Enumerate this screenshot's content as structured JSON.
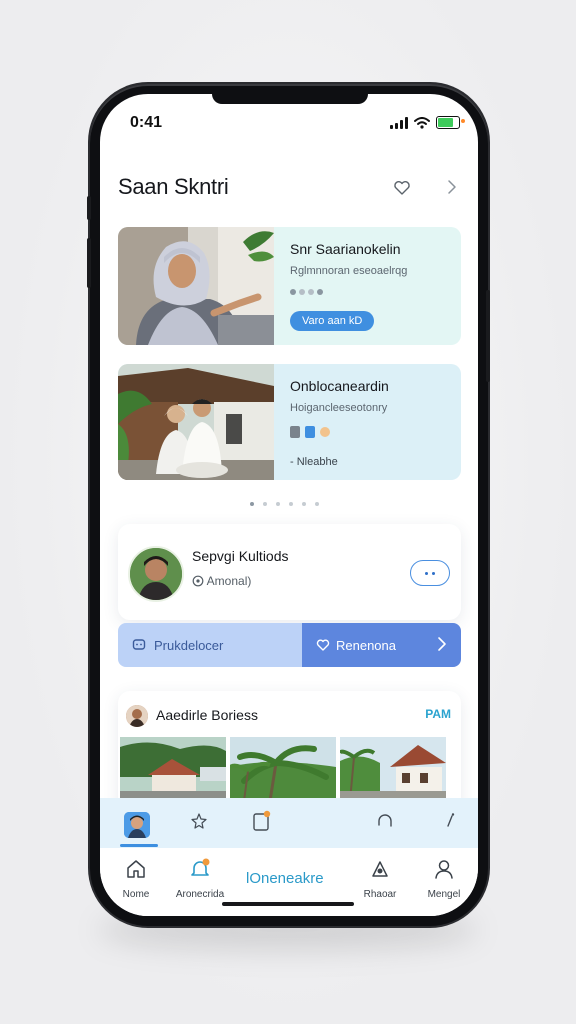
{
  "status_bar": {
    "time": "0:41"
  },
  "header": {
    "title": "Saan Skntri"
  },
  "cards": [
    {
      "title": "Snr Saarianokelin",
      "subtitle": "Rglmnnoran eseoaelrqg",
      "button_label": "Varo aan kD"
    },
    {
      "title": "Onblocaneardin",
      "subtitle": "Hoigancleeseotonry",
      "footer": "Nleabhe"
    }
  ],
  "profile": {
    "name": "Sepvgi Kultiods",
    "sub": "Amonal)"
  },
  "split_bar": {
    "left_label": "Prukdelocer",
    "right_label": "Renenona"
  },
  "gallery": {
    "title": "Aaedirle Boriess",
    "link": "PAM"
  },
  "tabs": [
    {
      "label": "Nome",
      "icon": "home-icon"
    },
    {
      "label": "Aronecrida",
      "icon": "bell-icon"
    },
    {
      "label": "lOneneakre",
      "icon": "center-label"
    },
    {
      "label": "Rhaoar",
      "icon": "explore-icon"
    },
    {
      "label": "Mengel",
      "icon": "user-icon"
    }
  ],
  "colors": {
    "accent": "#3f8fe0",
    "card1_bg": "#e3f6f4",
    "card2_bg": "#dcf0f7",
    "split_left": "#bcd2f7",
    "split_right": "#5d86de",
    "quick_bar": "#e3f2fb",
    "link": "#2ba3cf",
    "battery": "#3ecb5b"
  }
}
